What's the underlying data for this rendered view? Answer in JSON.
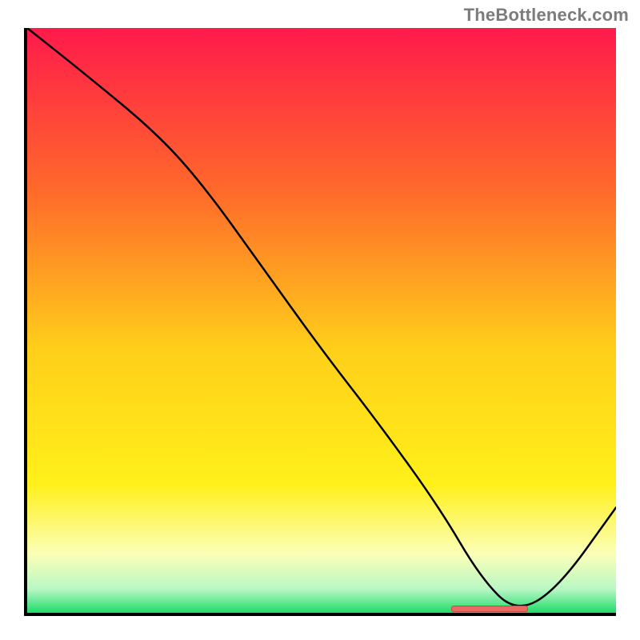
{
  "watermark": "TheBottleneck.com",
  "colors": {
    "gradient_top": "#ff1a4b",
    "gradient_mid_upper": "#ff8a2a",
    "gradient_mid": "#ffe21a",
    "gradient_lower": "#fff9b0",
    "gradient_bottom": "#1edb68",
    "axis": "#000000",
    "curve": "#000000",
    "marker": "#e86a62"
  },
  "chart_data": {
    "type": "line",
    "title": "",
    "xlabel": "",
    "ylabel": "",
    "xlim": [
      0,
      100
    ],
    "ylim": [
      0,
      100
    ],
    "series": [
      {
        "name": "curve",
        "x": [
          0,
          10,
          22,
          30,
          40,
          50,
          60,
          70,
          77,
          83,
          90,
          100
        ],
        "y": [
          100,
          92,
          82,
          73,
          59,
          45,
          32,
          18,
          6,
          0,
          4,
          18
        ]
      }
    ],
    "min_marker": {
      "x_start": 72,
      "x_end": 85,
      "y": 0
    }
  }
}
